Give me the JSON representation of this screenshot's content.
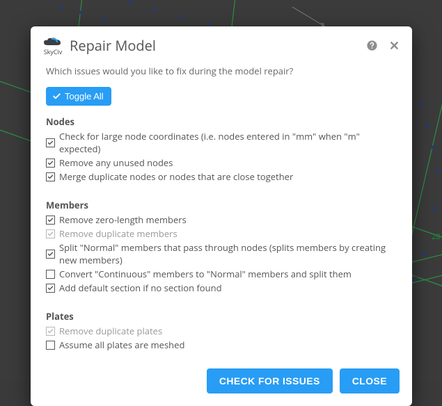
{
  "brand": "SkyCiv",
  "modal": {
    "title": "Repair Model",
    "intro": "Which issues would you like to fix during the model repair?",
    "toggle_all_label": "Toggle All"
  },
  "sections": {
    "nodes": {
      "title": "Nodes",
      "items": [
        {
          "label": "Check for large node coordinates (i.e. nodes entered in \"mm\" when \"m\" expected)",
          "checked": true,
          "disabled": false
        },
        {
          "label": "Remove any unused nodes",
          "checked": true,
          "disabled": false
        },
        {
          "label": "Merge duplicate nodes or nodes that are close together",
          "checked": true,
          "disabled": false
        }
      ]
    },
    "members": {
      "title": "Members",
      "items": [
        {
          "label": "Remove zero-length members",
          "checked": true,
          "disabled": false
        },
        {
          "label": "Remove duplicate members",
          "checked": true,
          "disabled": true
        },
        {
          "label": "Split \"Normal\" members that pass through nodes (splits members by creating new members)",
          "checked": true,
          "disabled": false
        },
        {
          "label": "Convert \"Continuous\" members to \"Normal\" members and split them",
          "checked": false,
          "disabled": false
        },
        {
          "label": "Add default section if no section found",
          "checked": true,
          "disabled": false
        }
      ]
    },
    "plates": {
      "title": "Plates",
      "items": [
        {
          "label": "Remove duplicate plates",
          "checked": true,
          "disabled": true
        },
        {
          "label": "Assume all plates are meshed",
          "checked": false,
          "disabled": false
        }
      ]
    }
  },
  "footer": {
    "check": "CHECK FOR ISSUES",
    "close": "CLOSE"
  },
  "background_labels": {
    "axis": "3",
    "node": "28"
  }
}
